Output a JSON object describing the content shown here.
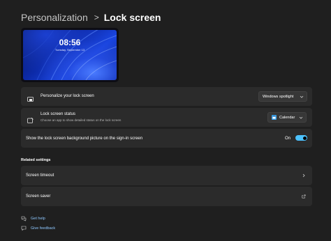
{
  "breadcrumb": {
    "parent": "Personalization",
    "separator": ">",
    "current": "Lock screen"
  },
  "preview": {
    "time": "08:56",
    "date": "Tuesday, September 13"
  },
  "settings": {
    "personalize": {
      "label": "Personalize your lock screen",
      "value": "Windows spotlight",
      "icon": "lockscreen-monitor-icon"
    },
    "status": {
      "label": "Lock screen status",
      "description": "Choose an app to show detailed status on the lock screen",
      "value": "Calendar",
      "icon": "lockscreen-status-icon"
    },
    "signin_background": {
      "label": "Show the lock screen background picture on the sign-in screen",
      "state_label": "On",
      "state": true
    }
  },
  "related": {
    "title": "Related settings",
    "items": [
      {
        "label": "Screen timeout",
        "icon": "chevron-right-icon"
      },
      {
        "label": "Screen saver",
        "icon": "external-link-icon"
      }
    ]
  },
  "help": {
    "get_help": "Get help",
    "give_feedback": "Give feedback"
  },
  "colors": {
    "accent": "#4cc2ff",
    "background": "#1f1f1f",
    "card": "#2b2b2b",
    "link": "#8fc8ff"
  }
}
